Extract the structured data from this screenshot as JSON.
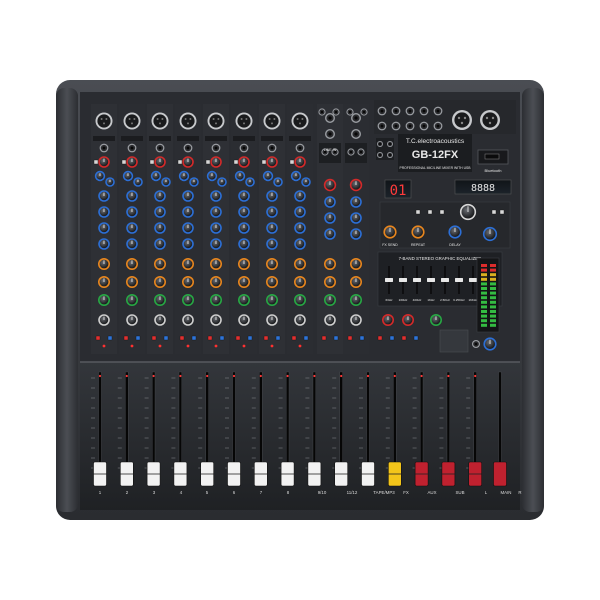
{
  "brand": "T.C.electroacoustics",
  "model": "GB-12FX",
  "subtitle": "PROFESSIONAL MIC/LINE MIXER WITH USB",
  "fx_display": "01",
  "usb_display": "8888",
  "bluetooth_label": "Bluetooth",
  "eq": {
    "title": "7-BAND STEREO GRAPHIC EQUALIZER",
    "bands": [
      "63Hz",
      "160Hz",
      "400Hz",
      "1KHz",
      "2.5KHz",
      "6.25KHz",
      "16KHz"
    ]
  },
  "fx_labels": {
    "fx_send": "FX SEND",
    "repeat": "REPEAT",
    "delay": "DELAY"
  },
  "line_in_label": "LINE IN",
  "channel_numbers": [
    "1",
    "2",
    "3",
    "4",
    "5",
    "6",
    "7",
    "8",
    "9/10",
    "11/12",
    "TAPE/MP3",
    "FX",
    "AUX",
    "SUB",
    "L",
    "MAIN",
    "R"
  ],
  "colors": {
    "body": "#3a3c41",
    "panel": "#23252a",
    "knob_blue": "#2c6fd6",
    "knob_orange": "#e8861e",
    "knob_green": "#27a844",
    "knob_red": "#d42a2a",
    "fader_white": "#f2f2f2",
    "fader_yellow": "#f3c51a",
    "fader_red": "#c0212f"
  }
}
